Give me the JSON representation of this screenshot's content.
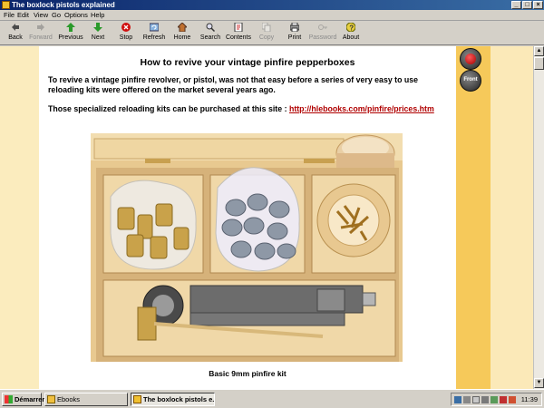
{
  "window": {
    "title": "The boxlock pistols explained"
  },
  "menu": [
    "File",
    "Edit",
    "View",
    "Go",
    "Options",
    "Help"
  ],
  "toolbar": [
    {
      "label": "Back",
      "icon": "back-arrow-icon",
      "enabled": true
    },
    {
      "label": "Forward",
      "icon": "forward-arrow-icon",
      "enabled": false
    },
    {
      "label": "Previous",
      "icon": "up-arrow-icon",
      "enabled": true
    },
    {
      "label": "Next",
      "icon": "down-arrow-icon",
      "enabled": true
    },
    {
      "label": "Stop",
      "icon": "stop-icon",
      "enabled": true
    },
    {
      "label": "Refresh",
      "icon": "refresh-icon",
      "enabled": true
    },
    {
      "label": "Home",
      "icon": "home-icon",
      "enabled": true
    },
    {
      "label": "Search",
      "icon": "search-icon",
      "enabled": true
    },
    {
      "label": "Contents",
      "icon": "contents-icon",
      "enabled": true
    },
    {
      "label": "Copy",
      "icon": "copy-icon",
      "enabled": false
    },
    {
      "label": "Print",
      "icon": "print-icon",
      "enabled": true
    },
    {
      "label": "Password",
      "icon": "key-icon",
      "enabled": false
    },
    {
      "label": "About",
      "icon": "about-icon",
      "enabled": true
    }
  ],
  "page": {
    "heading": "How to revive your vintage pinfire pepperboxes",
    "paragraph1": "To revive a vintage pinfire revolver, or pistol, was not that easy before a series of very easy to use reloading kits were offered on the market several years ago.",
    "paragraph2_prefix": "Those specialized reloading kits can be purchased at this site : ",
    "paragraph2_link": "http://hlebooks.com/pinfire/prices.htm",
    "photo_caption": "Basic 9mm pinfire kit"
  },
  "nav_buttons": {
    "back": "back-nav-icon",
    "front": "Front"
  },
  "taskbar": {
    "start": "Démarrer",
    "tasks": [
      {
        "label": "Ebooks",
        "active": false
      },
      {
        "label": "The boxlock pistols e...",
        "active": true
      }
    ],
    "clock": "11:39"
  },
  "colors": {
    "title_bar": "#0a246a",
    "link": "#b00000",
    "side_band": "#f6c95a",
    "background": "#fbe9b8"
  }
}
